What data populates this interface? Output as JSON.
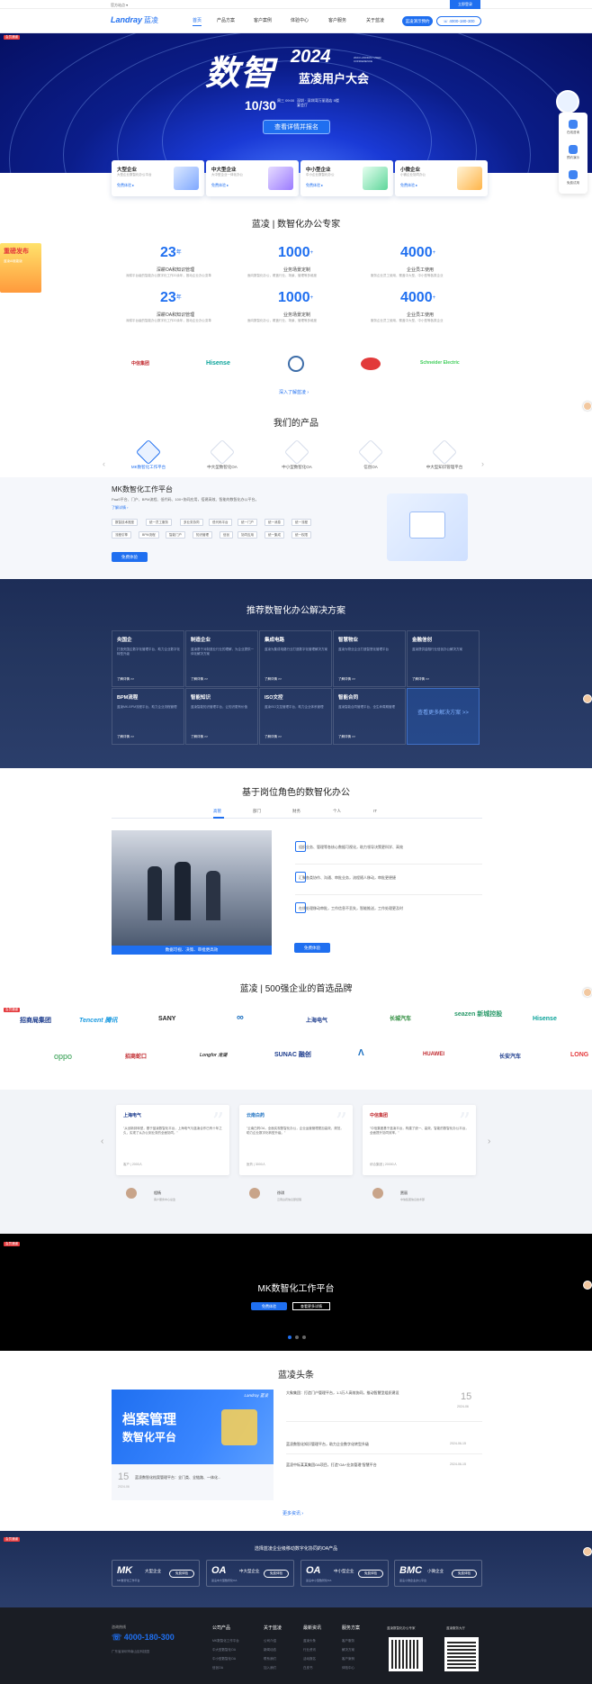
{
  "topbar": {
    "site": "官方站点 ▾",
    "login": "立即登录"
  },
  "nav": {
    "logo_en": "Landray",
    "logo_cn": "蓝凌",
    "items": [
      "首页",
      "产品方案",
      "客户案例",
      "体验中心",
      "客户服务",
      "关于蓝凌"
    ],
    "cta": "蓝凌演示预约",
    "phone": "4000-180-300"
  },
  "hero": {
    "title": "数智",
    "year": "2024",
    "subtitle": "蓝凌用户大会",
    "mini": "2024 LANDRAY USER CONFERENCE",
    "date": "10/30",
    "date_info": "周三 09:00",
    "location": "深圳 · 深圳湾万丽酒店 5楼宴会厅",
    "button": "查看详情并报名",
    "badge": "会员通道"
  },
  "segments": [
    {
      "title": "大型企业",
      "desc": "大型企业数智化办公平台",
      "link": "免费体验 ▸"
    },
    {
      "title": "中大型企业",
      "desc": "大中型企业一体化办公",
      "link": "免费体验 ▸"
    },
    {
      "title": "中小型企业",
      "desc": "中小企业数智化办公",
      "link": "免费体验 ▸"
    },
    {
      "title": "小微企业",
      "desc": "小微企业协同办公",
      "link": "免费体验 ▸"
    }
  ],
  "side_widgets": [
    "在线咨询",
    "预约演示",
    "免费试用"
  ],
  "expert": {
    "title": "蓝凌 | 数智化办公专家",
    "stats_row1": [
      {
        "num": "23",
        "unit": "年",
        "label": "深耕OA和知识管理",
        "desc": "深耕平台级的智能办公数字化工作20余年，推动企业办公变革"
      },
      {
        "num": "1000",
        "unit": "+",
        "label": "业务场景定制",
        "desc": "面向数智化办公，覆盖行业、场景、管理等多维度"
      },
      {
        "num": "4000",
        "unit": "+",
        "label": "企业员工使用",
        "desc": "服务企业员工使用，覆盖中大型、中小型等各类企业"
      }
    ],
    "stats_row2": [
      {
        "num": "23",
        "unit": "年",
        "label": "深耕OA和知识管理",
        "desc": "深耕平台级的智能办公数字化工作20余年，推动企业办公变革"
      },
      {
        "num": "1000",
        "unit": "+",
        "label": "业务场景定制",
        "desc": "面向数智化办公，覆盖行业、场景、管理等多维度"
      },
      {
        "num": "4000",
        "unit": "+",
        "label": "企业员工使用",
        "desc": "服务企业员工使用，覆盖中大型、中小型等各类企业"
      }
    ],
    "logos": [
      "中信集团",
      "Hisense",
      "●",
      "●",
      "Schneider Electric"
    ],
    "more": "深入了解蓝凌 ›"
  },
  "left_promo": {
    "title": "重磅发布",
    "sub": "蓝凌AI赋能版"
  },
  "products": {
    "title": "我们的产品",
    "tabs": [
      "MK数智化工作平台",
      "中大型数智化OA",
      "中小型数智化OA",
      "信创OA",
      "中大型知识管理平台"
    ],
    "panel_title": "MK数智化工作平台",
    "panel_desc": "PaaS平台、门户、BPM流程、低代码、100+协同应用，搭建高效、智能的数智化办公平台。",
    "panel_link": "了解详情 ›",
    "tags_row1": [
      "数智技术底座",
      "统一员工服务",
      "多业务协同",
      "低代码平台",
      "统一门户",
      "统一消息",
      "统一流程"
    ],
    "tags_row2": [
      "流程引擎",
      "BPM流程",
      "智能门户",
      "知识管理",
      "信创",
      "协同应用",
      "统一集成",
      "统一权限"
    ],
    "button": "免费体验"
  },
  "solutions": {
    "title": "推荐数智化办公解决方案",
    "cells": [
      {
        "title": "央国企",
        "desc": "打造央国企数字化管理平台，助力企业数字化转型升级",
        "link": "了解详情 >>"
      },
      {
        "title": "制造企业",
        "desc": "蓝凌基于对制造业行业的理解，为企业提供一体化解决方案",
        "link": "了解详情 >>"
      },
      {
        "title": "集成电路",
        "desc": "蓝凌为集成电路行业打造数字化管理解决方案",
        "link": "了解详情 >>"
      },
      {
        "title": "智慧物业",
        "desc": "蓝凌为物业企业打造智慧化管理平台",
        "link": "了解详情 >>"
      },
      {
        "title": "金融信创",
        "desc": "蓝凌提供金融行业信创办公解决方案",
        "link": "了解详情 >>"
      },
      {
        "title": "BPM流程",
        "desc": "蓝凌MK-BPM流程平台，助力企业流程管理",
        "link": "了解详情 >>"
      },
      {
        "title": "智能知识",
        "desc": "蓝凌智能知识管理平台，让知识更有价值",
        "link": "了解详情 >>"
      },
      {
        "title": "ISO文控",
        "desc": "蓝凌ISO文控管理平台，助力企业体系管理",
        "link": "了解详情 >>"
      },
      {
        "title": "智能合同",
        "desc": "蓝凌智能合同管理平台，全生命周期管理",
        "link": "了解详情 >>"
      },
      {
        "title": "查看更多解决方案 >>",
        "desc": "",
        "link": ""
      }
    ]
  },
  "roles": {
    "title": "基于岗位角色的数智化办公",
    "tabs": [
      "高管",
      "部门",
      "财务",
      "个人",
      "IT"
    ],
    "caption": "数据可视、决策、审批更高效",
    "items": [
      "组织业务、管理等各核心数据可视化，助力领导决策更科学、高效",
      "汇聚各类协作、沟通、审批业务，流程随人移动，审批更便捷",
      "在线处理移动审批，工作信息不丢失，智能推送，工作处理更及时"
    ],
    "button": "免费体验"
  },
  "brands": {
    "title": "蓝凌 | 500强企业的首选品牌",
    "row1": [
      "招商局集团",
      "Tencent 腾讯",
      "SANY",
      "∞",
      "上海电气",
      "长城汽车",
      "seazen 新城控股",
      "Hisense"
    ],
    "row2": [
      "oppo",
      "招商蛇口",
      "Longfor 龙湖",
      "SUNAC 融创",
      "Λ",
      "HUAWEI",
      "长安汽车",
      "LONG"
    ]
  },
  "testimonials": [
    {
      "brand": "上海电气",
      "text": "\"从创新到转型，基于蓝凌数智化平台，上海电气与蓝凌合作已有十年之久，实现了从办公到业务的全面协同。\"",
      "meta": "客户 | 2000人",
      "name": "程杨",
      "title": "客户服务中心总监"
    },
    {
      "brand": "云南白药",
      "text": "\"云南白药OA，全面实现数智化办公，企业运营管理更加高效、规范，助力企业数字化转型升级。\"",
      "meta": "医药 | 3000人",
      "name": "徐琪",
      "title": "云南白药信息部经理"
    },
    {
      "brand": "中信集团",
      "text": "\"中信集团基于蓝凌平台，构建了统一、高效、智能的数智化办公平台，全面提升协同效率。\"",
      "meta": "综合集团 | 20000人",
      "name": "贾丽",
      "title": "中信集团信息技术部"
    }
  ],
  "mk_banner": {
    "title": "MK数智化工作平台",
    "btn1": "免费体验",
    "btn2": "查看更多详情"
  },
  "news": {
    "title": "蓝凌头条",
    "feature": {
      "brand": "Landray 蓝凌",
      "line1": "档案管理",
      "line2": "数智化平台",
      "day": "15",
      "date": "2024-06",
      "caption": "蓝凌数智化档案管理平台：全门类、全链路、一体化..."
    },
    "items": [
      {
        "text": "大象集团：打造门户管理平台，1.3万人高效协同，推动智慧型组织建设",
        "day": "15",
        "date": "2024-06"
      },
      {
        "text": "蓝凌数智化知识管理平台，助力企业数字化转型升级",
        "date": "2024-06-15"
      },
      {
        "text": "蓝凌中标某某集团OA项目，打造\"OA+业务管理\"智慧平台",
        "date": "2024-06-15"
      }
    ],
    "more": "更多资讯 ›"
  },
  "cta": {
    "title": "选择蓝凌企业级移动数字化协同的OA产品",
    "cards": [
      {
        "logo": "MK",
        "name": "大型企业",
        "sub": "MK数智化工作平台",
        "btn": "免费体验"
      },
      {
        "logo": "OA",
        "name": "中大型企业",
        "sub": "蓝凌中大型数智化OA",
        "btn": "免费体验"
      },
      {
        "logo": "OA",
        "name": "中小型企业",
        "sub": "蓝凌中小型数智化OA",
        "btn": "免费体验"
      },
      {
        "logo": "BMC",
        "name": "小微企业",
        "sub": "蓝凌小微企业办公平台",
        "btn": "免费体验"
      }
    ]
  },
  "footer": {
    "contact_label": "咨询热线",
    "phone": "4000-180-300",
    "address": "广东省深圳市南山区科技园",
    "cols": [
      {
        "title": "公司产品",
        "items": [
          "MK数智化工作平台",
          "中大型数智化OA",
          "中小型数智化OA",
          "信创OA"
        ]
      },
      {
        "title": "关于蓝凌",
        "items": [
          "公司介绍",
          "新闻动态",
          "联系我们",
          "加入我们"
        ]
      },
      {
        "title": "最新资讯",
        "items": [
          "蓝凌头条",
          "行业资讯",
          "活动报名",
          "白皮书"
        ]
      },
      {
        "title": "服务方案",
        "items": [
          "客户服务",
          "解决方案",
          "客户案例",
          "体验中心"
        ]
      }
    ],
    "qr1": "蓝凌数智化办公专家",
    "qr2": "蓝凌服务大厅"
  },
  "colors": {
    "brand": "#1f6ff0",
    "dark_navy": "#1d2d57",
    "footer": "#1a1d24"
  }
}
